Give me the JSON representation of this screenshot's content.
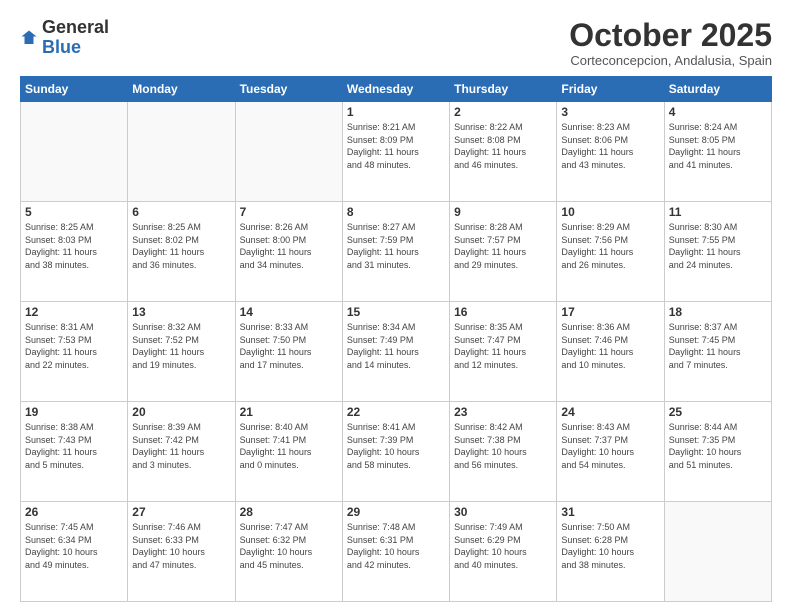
{
  "header": {
    "logo_general": "General",
    "logo_blue": "Blue",
    "title": "October 2025",
    "subtitle": "Corteconcepcion, Andalusia, Spain"
  },
  "weekdays": [
    "Sunday",
    "Monday",
    "Tuesday",
    "Wednesday",
    "Thursday",
    "Friday",
    "Saturday"
  ],
  "weeks": [
    [
      {
        "day": "",
        "info": ""
      },
      {
        "day": "",
        "info": ""
      },
      {
        "day": "",
        "info": ""
      },
      {
        "day": "1",
        "info": "Sunrise: 8:21 AM\nSunset: 8:09 PM\nDaylight: 11 hours\nand 48 minutes."
      },
      {
        "day": "2",
        "info": "Sunrise: 8:22 AM\nSunset: 8:08 PM\nDaylight: 11 hours\nand 46 minutes."
      },
      {
        "day": "3",
        "info": "Sunrise: 8:23 AM\nSunset: 8:06 PM\nDaylight: 11 hours\nand 43 minutes."
      },
      {
        "day": "4",
        "info": "Sunrise: 8:24 AM\nSunset: 8:05 PM\nDaylight: 11 hours\nand 41 minutes."
      }
    ],
    [
      {
        "day": "5",
        "info": "Sunrise: 8:25 AM\nSunset: 8:03 PM\nDaylight: 11 hours\nand 38 minutes."
      },
      {
        "day": "6",
        "info": "Sunrise: 8:25 AM\nSunset: 8:02 PM\nDaylight: 11 hours\nand 36 minutes."
      },
      {
        "day": "7",
        "info": "Sunrise: 8:26 AM\nSunset: 8:00 PM\nDaylight: 11 hours\nand 34 minutes."
      },
      {
        "day": "8",
        "info": "Sunrise: 8:27 AM\nSunset: 7:59 PM\nDaylight: 11 hours\nand 31 minutes."
      },
      {
        "day": "9",
        "info": "Sunrise: 8:28 AM\nSunset: 7:57 PM\nDaylight: 11 hours\nand 29 minutes."
      },
      {
        "day": "10",
        "info": "Sunrise: 8:29 AM\nSunset: 7:56 PM\nDaylight: 11 hours\nand 26 minutes."
      },
      {
        "day": "11",
        "info": "Sunrise: 8:30 AM\nSunset: 7:55 PM\nDaylight: 11 hours\nand 24 minutes."
      }
    ],
    [
      {
        "day": "12",
        "info": "Sunrise: 8:31 AM\nSunset: 7:53 PM\nDaylight: 11 hours\nand 22 minutes."
      },
      {
        "day": "13",
        "info": "Sunrise: 8:32 AM\nSunset: 7:52 PM\nDaylight: 11 hours\nand 19 minutes."
      },
      {
        "day": "14",
        "info": "Sunrise: 8:33 AM\nSunset: 7:50 PM\nDaylight: 11 hours\nand 17 minutes."
      },
      {
        "day": "15",
        "info": "Sunrise: 8:34 AM\nSunset: 7:49 PM\nDaylight: 11 hours\nand 14 minutes."
      },
      {
        "day": "16",
        "info": "Sunrise: 8:35 AM\nSunset: 7:47 PM\nDaylight: 11 hours\nand 12 minutes."
      },
      {
        "day": "17",
        "info": "Sunrise: 8:36 AM\nSunset: 7:46 PM\nDaylight: 11 hours\nand 10 minutes."
      },
      {
        "day": "18",
        "info": "Sunrise: 8:37 AM\nSunset: 7:45 PM\nDaylight: 11 hours\nand 7 minutes."
      }
    ],
    [
      {
        "day": "19",
        "info": "Sunrise: 8:38 AM\nSunset: 7:43 PM\nDaylight: 11 hours\nand 5 minutes."
      },
      {
        "day": "20",
        "info": "Sunrise: 8:39 AM\nSunset: 7:42 PM\nDaylight: 11 hours\nand 3 minutes."
      },
      {
        "day": "21",
        "info": "Sunrise: 8:40 AM\nSunset: 7:41 PM\nDaylight: 11 hours\nand 0 minutes."
      },
      {
        "day": "22",
        "info": "Sunrise: 8:41 AM\nSunset: 7:39 PM\nDaylight: 10 hours\nand 58 minutes."
      },
      {
        "day": "23",
        "info": "Sunrise: 8:42 AM\nSunset: 7:38 PM\nDaylight: 10 hours\nand 56 minutes."
      },
      {
        "day": "24",
        "info": "Sunrise: 8:43 AM\nSunset: 7:37 PM\nDaylight: 10 hours\nand 54 minutes."
      },
      {
        "day": "25",
        "info": "Sunrise: 8:44 AM\nSunset: 7:35 PM\nDaylight: 10 hours\nand 51 minutes."
      }
    ],
    [
      {
        "day": "26",
        "info": "Sunrise: 7:45 AM\nSunset: 6:34 PM\nDaylight: 10 hours\nand 49 minutes."
      },
      {
        "day": "27",
        "info": "Sunrise: 7:46 AM\nSunset: 6:33 PM\nDaylight: 10 hours\nand 47 minutes."
      },
      {
        "day": "28",
        "info": "Sunrise: 7:47 AM\nSunset: 6:32 PM\nDaylight: 10 hours\nand 45 minutes."
      },
      {
        "day": "29",
        "info": "Sunrise: 7:48 AM\nSunset: 6:31 PM\nDaylight: 10 hours\nand 42 minutes."
      },
      {
        "day": "30",
        "info": "Sunrise: 7:49 AM\nSunset: 6:29 PM\nDaylight: 10 hours\nand 40 minutes."
      },
      {
        "day": "31",
        "info": "Sunrise: 7:50 AM\nSunset: 6:28 PM\nDaylight: 10 hours\nand 38 minutes."
      },
      {
        "day": "",
        "info": ""
      }
    ]
  ]
}
